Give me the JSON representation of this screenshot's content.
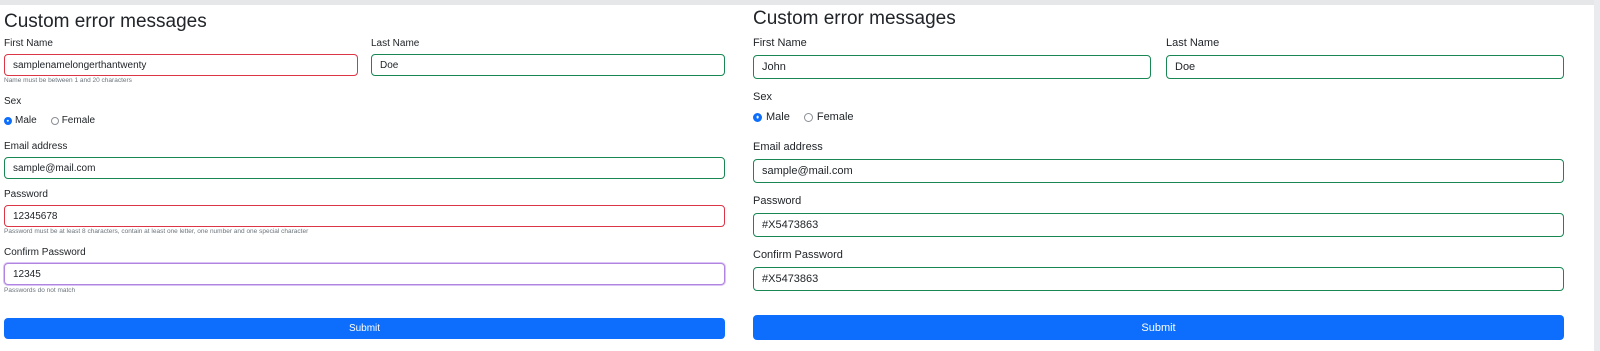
{
  "left": {
    "title": "Custom error messages",
    "first_name": {
      "label": "First Name",
      "value": "samplenamelongerthantwenty",
      "status": "invalid",
      "error": "Name must be between 1 and 20 characters"
    },
    "last_name": {
      "label": "Last Name",
      "value": "Doe",
      "status": "valid"
    },
    "sex": {
      "label": "Sex",
      "options": [
        "Male",
        "Female"
      ],
      "selected": "Male"
    },
    "email": {
      "label": "Email address",
      "value": "sample@mail.com",
      "status": "valid"
    },
    "password": {
      "label": "Password",
      "value": "12345678",
      "status": "invalid",
      "error": "Password must be at least 8 characters, contain at least one letter, one number and one special character"
    },
    "confirm_password": {
      "label": "Confirm Password",
      "value": "12345",
      "status": "invalid-focused",
      "error": "Passwords do not match"
    },
    "submit_label": "Submit"
  },
  "right": {
    "title": "Custom error messages",
    "first_name": {
      "label": "First Name",
      "value": "John",
      "status": "valid"
    },
    "last_name": {
      "label": "Last Name",
      "value": "Doe",
      "status": "valid"
    },
    "sex": {
      "label": "Sex",
      "options": [
        "Male",
        "Female"
      ],
      "selected": "Male"
    },
    "email": {
      "label": "Email address",
      "value": "sample@mail.com",
      "status": "valid"
    },
    "password": {
      "label": "Password",
      "value": "#X5473863",
      "status": "valid"
    },
    "confirm_password": {
      "label": "Confirm Password",
      "value": "#X5473863",
      "status": "valid"
    },
    "submit_label": "Submit"
  },
  "colors": {
    "valid_border": "#198754",
    "invalid_border": "#dc3545",
    "primary": "#0d6efd",
    "hint_text": "#6c757d"
  }
}
